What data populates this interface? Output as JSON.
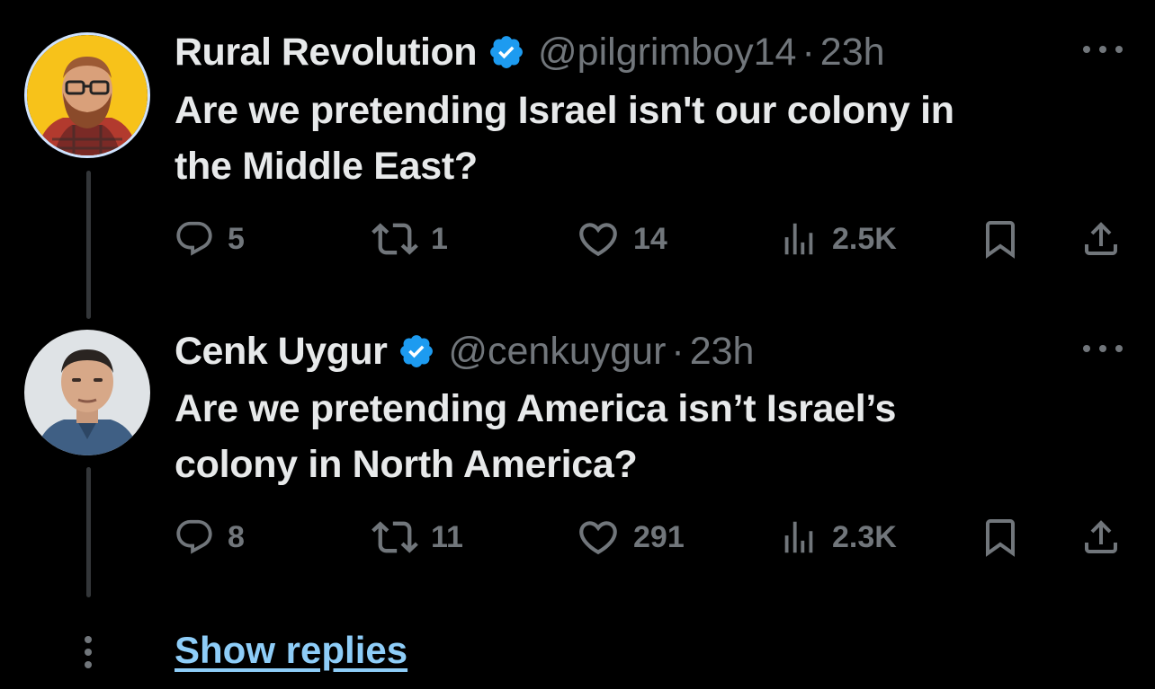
{
  "tweets": [
    {
      "name": "Rural Revolution",
      "handle": "@pilgrimboy14",
      "separator": "·",
      "time": "23h",
      "text_line1": "Are we pretending Israel isn't our colony in",
      "text_line2": "the Middle East?",
      "replies": "5",
      "retweets": "1",
      "likes": "14",
      "views": "2.5K"
    },
    {
      "name": "Cenk Uygur",
      "handle": "@cenkuygur",
      "separator": "·",
      "time": "23h",
      "text_line1": "Are we pretending America isn’t Israel’s",
      "text_line2": "colony in North America?",
      "replies": "8",
      "retweets": "11",
      "likes": "291",
      "views": "2.3K"
    }
  ],
  "show_replies_label": "Show replies",
  "icons": {
    "verified": "verified-badge-icon",
    "more": "more-icon",
    "reply": "reply-icon",
    "retweet": "retweet-icon",
    "like": "like-icon",
    "views": "views-icon",
    "bookmark": "bookmark-icon",
    "share": "share-icon"
  },
  "colors": {
    "background": "#000000",
    "text": "#e7e9ea",
    "secondary": "#71767b",
    "verified": "#1d9bf0",
    "link": "#8ecdf8"
  }
}
